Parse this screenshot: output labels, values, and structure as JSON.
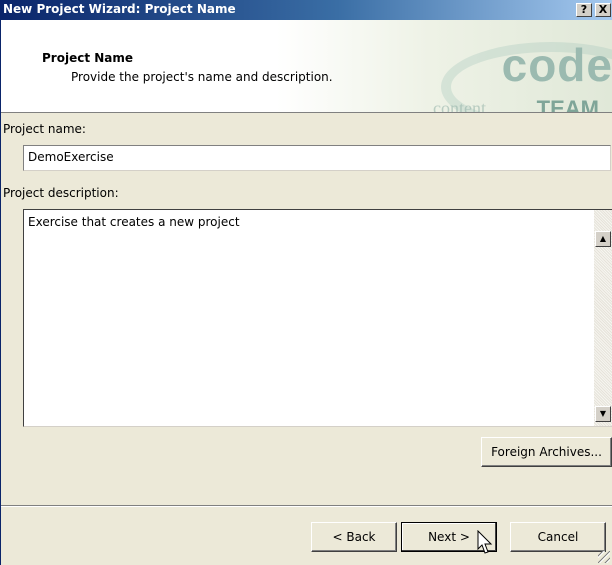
{
  "window": {
    "title": "New Project Wizard: Project Name",
    "help_label": "?",
    "close_label": "X"
  },
  "header": {
    "title": "Project Name",
    "subtitle": "Provide the project's name and description.",
    "logo": {
      "code_word": "code",
      "content_word": "content",
      "team_word": "TEAM"
    }
  },
  "form": {
    "name_label": "Project name:",
    "name_value": "DemoExercise",
    "description_label": "Project description:",
    "description_value": "Exercise that creates a new project"
  },
  "buttons": {
    "foreign_archives": "Foreign Archives...",
    "back": "< Back",
    "next": "Next >",
    "cancel": "Cancel"
  },
  "icons": {
    "scroll_up": "scroll-up-arrow-icon",
    "scroll_down": "scroll-down-arrow-icon",
    "cursor": "mouse-pointer-icon",
    "resize_grip": "resize-grip-icon"
  },
  "colors": {
    "titlebar_start": "#0a246a",
    "titlebar_end": "#a6caf0",
    "dialog_face": "#ece9d8"
  }
}
